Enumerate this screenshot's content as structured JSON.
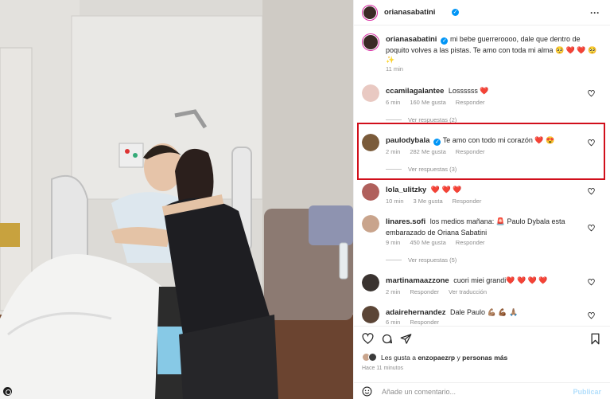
{
  "post": {
    "author": "orianasabatini",
    "caption": "mi bebe guerreroooo, dale que dentro de poquito volves a las pistas. Te amo con toda mi alma 🥺 ❤️ ❤️ 🥺 ✨",
    "caption_time": "11 min",
    "more_icon": "more-horizontal-icon"
  },
  "comments": [
    {
      "user": "ccamilagalantee",
      "text": "Lossssss ❤️",
      "time": "6 min",
      "likes": "160 Me gusta",
      "reply": "Responder",
      "verified": false,
      "avatar_color": "#e9c9c2",
      "view_replies": "Ver respuestas (2)"
    },
    {
      "user": "paulodybala",
      "text": "Te amo con todo mi corazón ❤️ 😍",
      "time": "2 min",
      "likes": "282 Me gusta",
      "reply": "Responder",
      "verified": true,
      "avatar_color": "#7a5b3a",
      "view_replies": "Ver respuestas (3)"
    },
    {
      "user": "lola_ulitzky",
      "text": "❤️ ❤️ ❤️",
      "time": "10 min",
      "likes": "3 Me gusta",
      "reply": "Responder",
      "verified": false,
      "avatar_color": "#b0605c"
    },
    {
      "user": "linares.sofi",
      "text": "los medios mañana: 🚨 Paulo Dybala esta embarazado de Oriana Sabatini",
      "time": "9 min",
      "likes": "450 Me gusta",
      "reply": "Responder",
      "verified": false,
      "avatar_color": "#c9a48c",
      "view_replies": "Ver respuestas (5)"
    },
    {
      "user": "martinamaazzone",
      "text": "cuori miei grandi❤️ ❤️ ❤️ ❤️",
      "time": "2 min",
      "likes": "Responder",
      "reply": "Ver traducción",
      "verified": false,
      "avatar_color": "#3a3330"
    },
    {
      "user": "adairehernandez",
      "text": "Dale Paulo 💪🏽 💪🏾 🙏🏽",
      "time": "6 min",
      "likes": "Responder",
      "reply": "",
      "verified": false,
      "avatar_color": "#5b4536"
    }
  ],
  "footer": {
    "liked_by_prefix": "Les gusta a",
    "liked_by_user": "enzopaezrp",
    "liked_by_suffix": "y personas más",
    "posted_ago": "Hace 11 minutos",
    "comment_placeholder": "Añade un comentario...",
    "publish": "Publicar"
  },
  "colors": {
    "accent": "#0095f6",
    "highlight_border": "#d10f1b",
    "heart_red": "#e0245e"
  },
  "icons": [
    "heart-icon",
    "comment-icon",
    "share-icon",
    "bookmark-icon",
    "emoji-icon",
    "verified-badge-icon"
  ]
}
